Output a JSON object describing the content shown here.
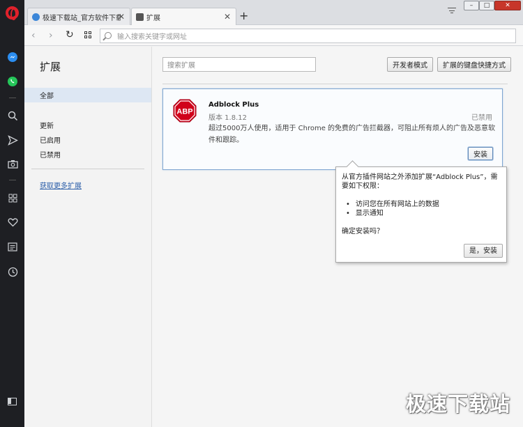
{
  "tabs": [
    {
      "title": "极速下载站_官方软件下载",
      "active": false
    },
    {
      "title": "扩展",
      "active": true
    }
  ],
  "address": {
    "placeholder": "输入搜索关键字或网址"
  },
  "window_controls": {
    "minimize": "–",
    "maximize": "□",
    "close": "✕"
  },
  "sidebar": {
    "title": "扩展",
    "items": [
      {
        "label": "全部"
      },
      {
        "label": "更新"
      },
      {
        "label": "已启用"
      },
      {
        "label": "已禁用"
      }
    ],
    "more_link": "获取更多扩展"
  },
  "toolbar": {
    "search_placeholder": "搜索扩展",
    "dev_mode": "开发者模式",
    "shortcuts": "扩展的键盘快捷方式"
  },
  "extension": {
    "icon_text": "ABP",
    "name": "Adblock Plus",
    "version": "版本 1.8.12",
    "status": "已禁用",
    "description": "超过5000万人使用，适用于 Chrome 的免费的广告拦截器，可阻止所有烦人的广告及恶意软件和跟踪。",
    "install": "安装"
  },
  "popup": {
    "message": "从官方插件网站之外添加扩展“Adblock Plus”，需要如下权限：",
    "permissions": [
      "访问您在所有网站上的数据",
      "显示通知"
    ],
    "confirm": "确定安装吗？",
    "yes": "是，安装"
  },
  "watermark": "极速下载站",
  "colors": {
    "opera_red": "#e0212b",
    "abp_red": "#d0021b",
    "selected_bg": "#dde7f3",
    "link": "#2a5da8"
  }
}
